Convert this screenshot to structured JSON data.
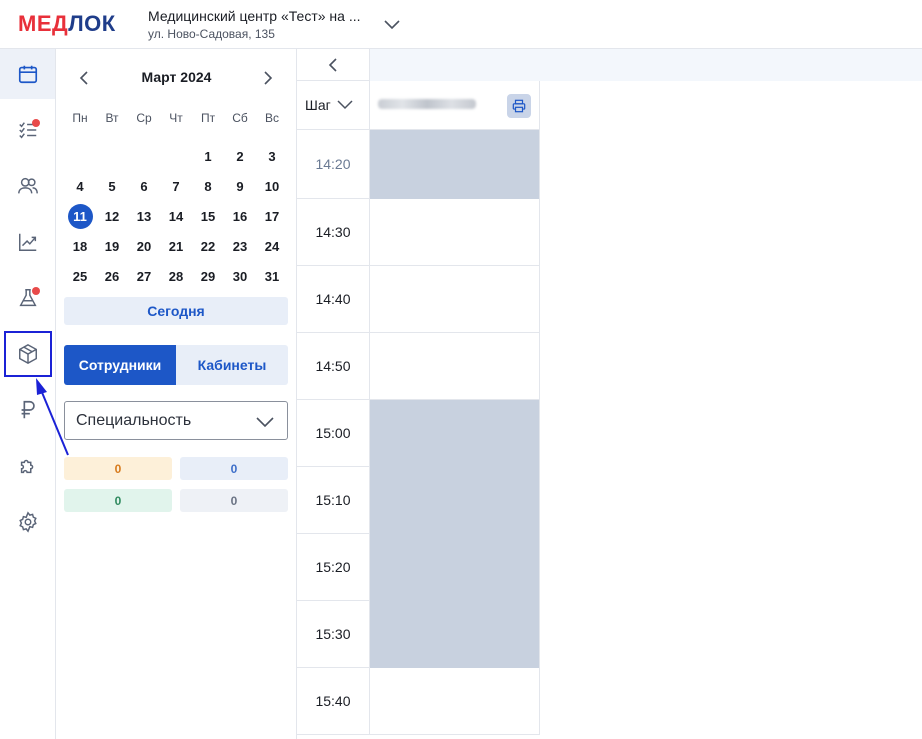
{
  "header": {
    "logo_part1": "МЕД",
    "logo_part2": "ЛОК",
    "clinic_name": "Медицинский центр «Тест» на ...",
    "clinic_address": "ул. Ново-Садовая, 135"
  },
  "nav": {
    "items": [
      {
        "name": "calendar",
        "icon": "calendar-icon",
        "active": true,
        "dot": false
      },
      {
        "name": "tasks",
        "icon": "checklist-icon",
        "active": false,
        "dot": true
      },
      {
        "name": "patients",
        "icon": "users-icon",
        "active": false,
        "dot": false
      },
      {
        "name": "analytics",
        "icon": "chart-icon",
        "active": false,
        "dot": false
      },
      {
        "name": "lab",
        "icon": "flask-icon",
        "active": false,
        "dot": true
      },
      {
        "name": "warehouse",
        "icon": "box-icon",
        "active": false,
        "dot": false,
        "highlighted": true
      },
      {
        "name": "finance",
        "icon": "ruble-icon",
        "active": false,
        "dot": false
      },
      {
        "name": "integrations",
        "icon": "puzzle-icon",
        "active": false,
        "dot": false
      },
      {
        "name": "settings",
        "icon": "gear-icon",
        "active": false,
        "dot": false
      }
    ]
  },
  "calendar": {
    "month_title": "Март 2024",
    "weekdays": [
      "Пн",
      "Вт",
      "Ср",
      "Чт",
      "Пт",
      "Сб",
      "Вс"
    ],
    "leading_blanks": 4,
    "days": [
      "1",
      "2",
      "3",
      "4",
      "5",
      "6",
      "7",
      "8",
      "9",
      "10",
      "11",
      "12",
      "13",
      "14",
      "15",
      "16",
      "17",
      "18",
      "19",
      "20",
      "21",
      "22",
      "23",
      "24",
      "25",
      "26",
      "27",
      "28",
      "29",
      "30",
      "31"
    ],
    "selected_day": "11",
    "today_label": "Сегодня"
  },
  "view_toggle": {
    "employees_label": "Сотрудники",
    "rooms_label": "Кабинеты",
    "active": "employees"
  },
  "specialty_select": {
    "value": "Специальность"
  },
  "counters": {
    "orange": "0",
    "blue": "0",
    "green": "0",
    "gray": "0"
  },
  "schedule": {
    "step_label": "Шаг",
    "times": [
      "14:20",
      "14:30",
      "14:40",
      "14:50",
      "15:00",
      "15:10",
      "15:20",
      "15:30",
      "15:40"
    ],
    "busy": [
      true,
      false,
      false,
      false,
      true,
      true,
      true,
      true,
      false
    ]
  },
  "colors": {
    "brand_red": "#e8303a",
    "brand_blue": "#1d57c7",
    "busy_slot": "#c8d1df",
    "annotation": "#1b22d6"
  }
}
